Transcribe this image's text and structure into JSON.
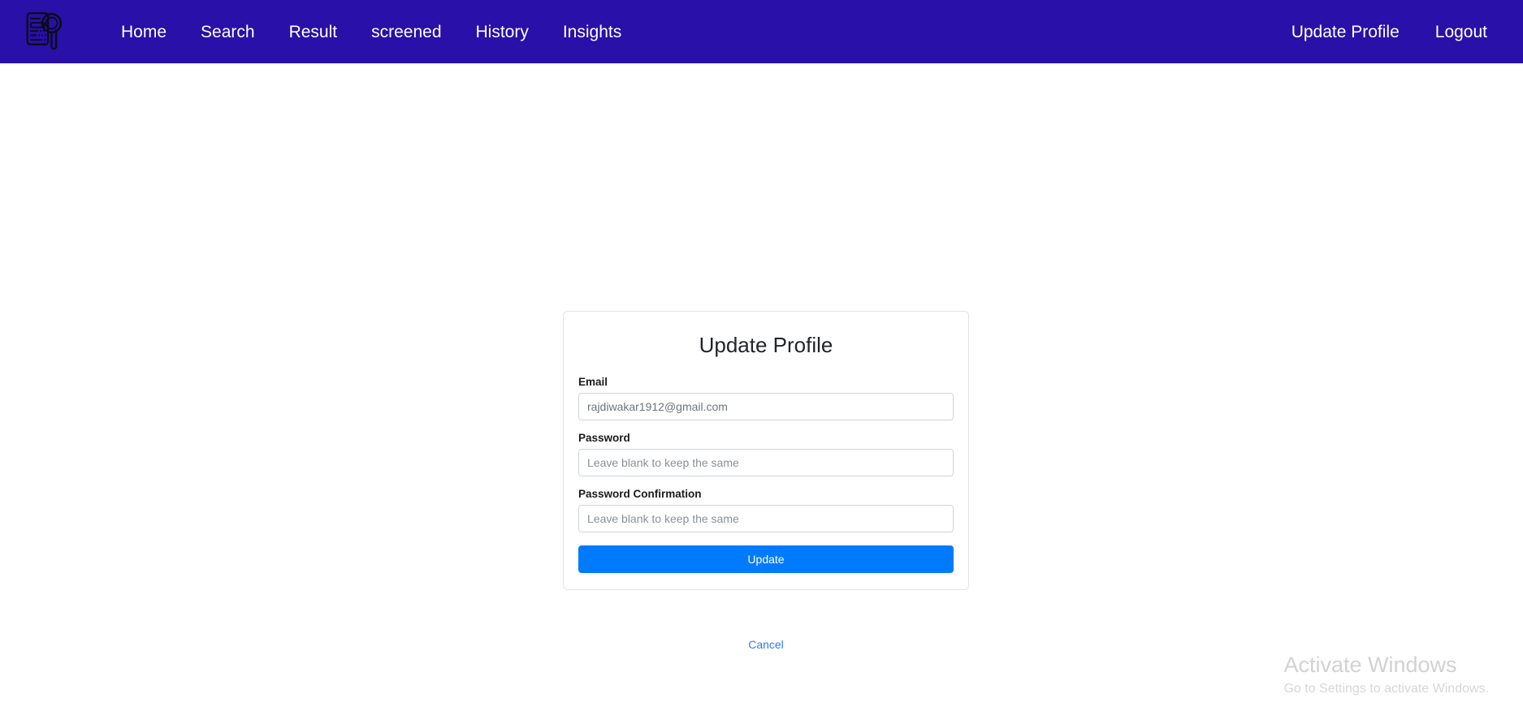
{
  "theme": {
    "navbar_bg": "#2810A8",
    "page_bg": "#ffffff",
    "primary_button": "#007bff",
    "link_color": "#2f7bf6",
    "card_border": "#e3e3e3",
    "input_border": "#ced4da",
    "muted_text": "#6c757d",
    "watermark_text": "#d2d2d2"
  },
  "navbar": {
    "logo_icon": "document-magnifier-icon",
    "left_items": [
      {
        "label": "Home",
        "name": "nav-link-home"
      },
      {
        "label": "Search",
        "name": "nav-link-search"
      },
      {
        "label": "Result",
        "name": "nav-link-result"
      },
      {
        "label": "screened",
        "name": "nav-link-screened"
      },
      {
        "label": "History",
        "name": "nav-link-history"
      },
      {
        "label": "Insights",
        "name": "nav-link-insights"
      }
    ],
    "right_items": [
      {
        "label": "Update Profile",
        "name": "nav-link-update-profile"
      },
      {
        "label": "Logout",
        "name": "nav-link-logout"
      }
    ]
  },
  "card": {
    "title": "Update Profile",
    "fields": [
      {
        "label": "Email",
        "value": "rajdiwakar1912@gmail.com",
        "placeholder": "",
        "type": "email"
      },
      {
        "label": "Password",
        "value": "",
        "placeholder": "Leave blank to keep the same",
        "type": "password"
      },
      {
        "label": "Password Confirmation",
        "value": "",
        "placeholder": "Leave blank to keep the same",
        "type": "password"
      }
    ],
    "submit_label": "Update",
    "cancel_label": "Cancel"
  },
  "watermark": {
    "title": "Activate Windows",
    "subtitle": "Go to Settings to activate Windows."
  }
}
